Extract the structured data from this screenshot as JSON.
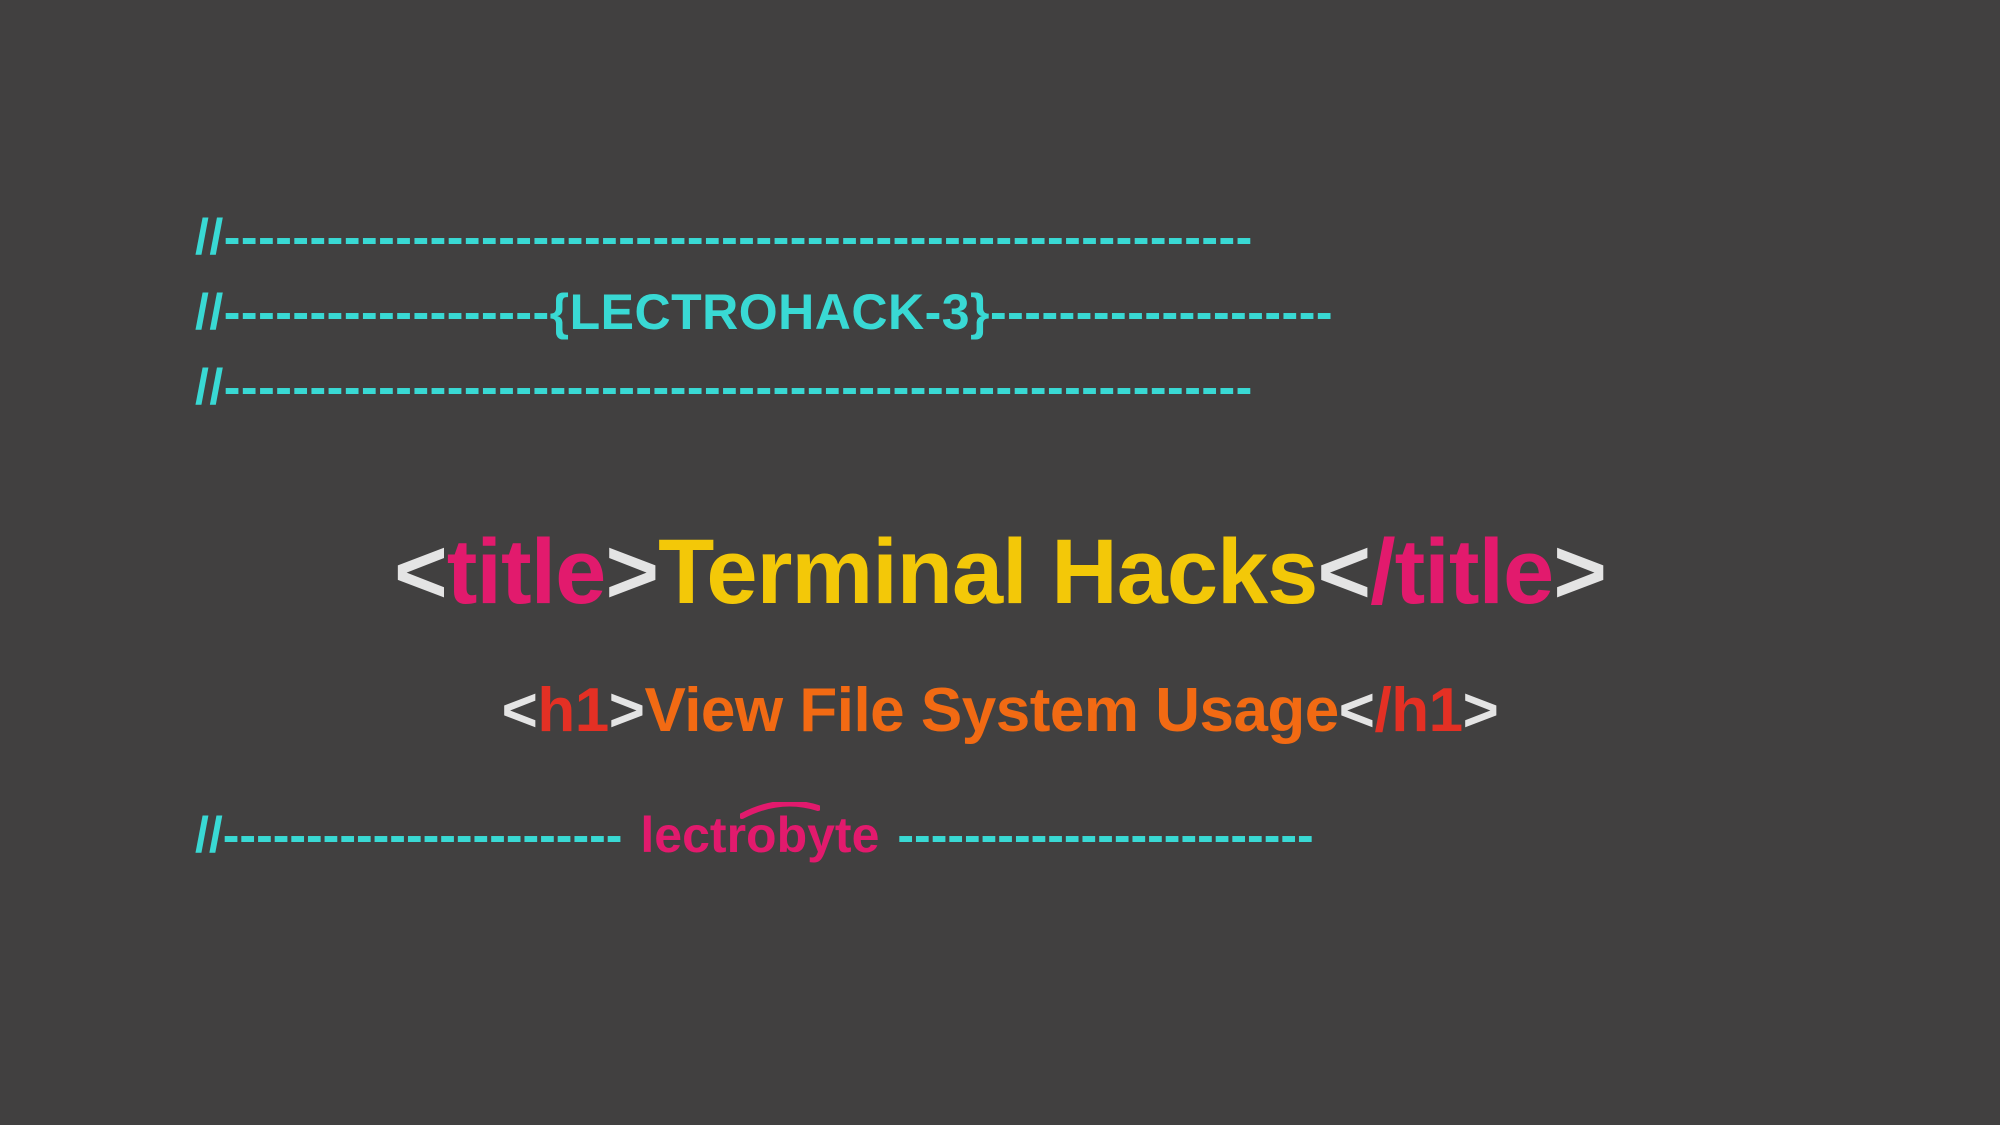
{
  "header": {
    "line1": "//------------------------------------------------------------",
    "line2_pre": "//-------------------",
    "line2_label": "{LECTROHACK-3}",
    "line2_post": "--------------------",
    "line3": "//------------------------------------------------------------"
  },
  "title": {
    "open_angle": "<",
    "open_tag": "title",
    "open_close_angle": ">",
    "text": "Terminal Hacks",
    "close_angle": "<",
    "close_slash_tag": "/title",
    "close_close_angle": ">"
  },
  "subtitle": {
    "open_angle": "<",
    "open_tag": "h1",
    "open_close_angle": ">",
    "text": "View File System Usage",
    "close_angle": "<",
    "close_slash_tag": "/h1",
    "close_close_angle": ">"
  },
  "footer": {
    "pre": "//------------------------",
    "brand_left": "lectr",
    "brand_o": "o",
    "brand_right": "byte",
    "post": "-------------------------"
  }
}
